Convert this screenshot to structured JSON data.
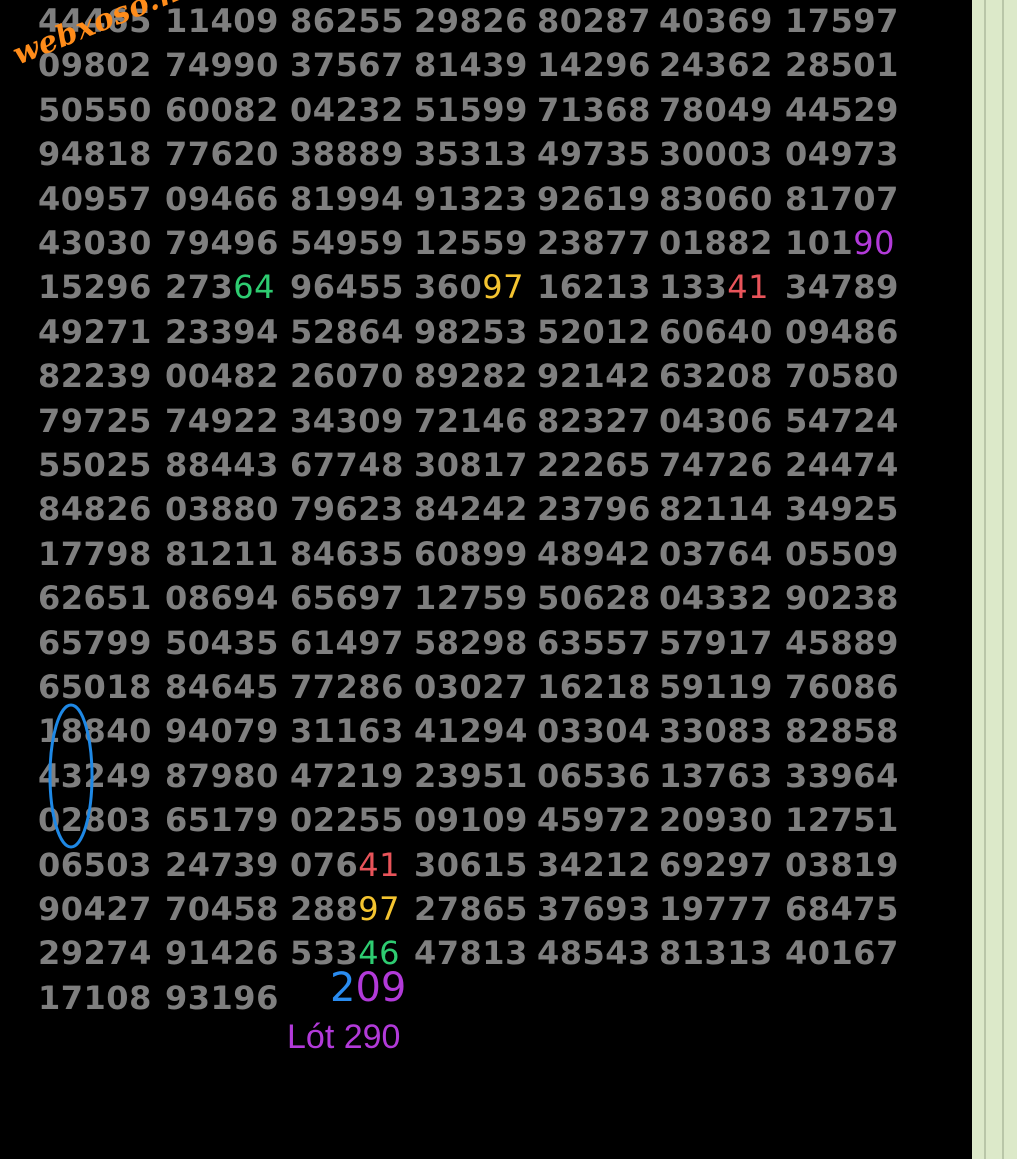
{
  "watermark": "webxoso.net",
  "rows": [
    [
      "44465",
      "11409",
      "86255",
      "29826",
      "80287",
      "40369",
      "17597"
    ],
    [
      "09802",
      "74990",
      "37567",
      "81439",
      "14296",
      "24362",
      "28501"
    ],
    [
      "50550",
      "60082",
      "04232",
      "51599",
      "71368",
      "78049",
      "44529"
    ],
    [
      "94818",
      "77620",
      "38889",
      "35313",
      "49735",
      "30003",
      "04973"
    ],
    [
      "40957",
      "09466",
      "81994",
      "91323",
      "92619",
      "83060",
      "81707"
    ],
    [
      "43030",
      "79496",
      "54959",
      "12559",
      "23877",
      "01882",
      "10190"
    ],
    [
      "15296",
      "27364",
      "96455",
      "36097",
      "16213",
      "13341",
      "34789"
    ],
    [
      "49271",
      "23394",
      "52864",
      "98253",
      "52012",
      "60640",
      "09486"
    ],
    [
      "82239",
      "00482",
      "26070",
      "89282",
      "92142",
      "63208",
      "70580"
    ],
    [
      "79725",
      "74922",
      "34309",
      "72146",
      "82327",
      "04306",
      "54724"
    ],
    [
      "55025",
      "88443",
      "67748",
      "30817",
      "22265",
      "74726",
      "24474"
    ],
    [
      "84826",
      "03880",
      "79623",
      "84242",
      "23796",
      "82114",
      "34925"
    ],
    [
      "17798",
      "81211",
      "84635",
      "60899",
      "48942",
      "03764",
      "05509"
    ],
    [
      "62651",
      "08694",
      "65697",
      "12759",
      "50628",
      "04332",
      "90238"
    ],
    [
      "65799",
      "50435",
      "61497",
      "58298",
      "63557",
      "57917",
      "45889"
    ],
    [
      "65018",
      "84645",
      "77286",
      "03027",
      "16218",
      "59119",
      "76086"
    ],
    [
      "18840",
      "94079",
      "31163",
      "41294",
      "03304",
      "33083",
      "82858"
    ],
    [
      "43249",
      "87980",
      "47219",
      "23951",
      "06536",
      "13763",
      "33964"
    ],
    [
      "02803",
      "65179",
      "02255",
      "09109",
      "45972",
      "20930",
      "12751"
    ],
    [
      "06503",
      "24739",
      "07641",
      "30615",
      "34212",
      "69297",
      "03819"
    ],
    [
      "90427",
      "70458",
      "28897",
      "27865",
      "37693",
      "19777",
      "68475"
    ],
    [
      "29274",
      "91426",
      "53346",
      "47813",
      "48543",
      "81313",
      "40167"
    ],
    [
      "17108",
      "93196"
    ]
  ],
  "highlights": [
    {
      "row": 5,
      "col": 6,
      "digits": "90",
      "color": "#b23ad9"
    },
    {
      "row": 6,
      "col": 1,
      "digits": "64",
      "color": "#2ecc71"
    },
    {
      "row": 6,
      "col": 3,
      "digits": "97",
      "color": "#f4c430"
    },
    {
      "row": 6,
      "col": 5,
      "digits": "41",
      "color": "#e8545a"
    },
    {
      "row": 19,
      "col": 2,
      "digits": "41",
      "color": "#e8545a"
    },
    {
      "row": 20,
      "col": 2,
      "digits": "97",
      "color": "#f4c430"
    },
    {
      "row": 21,
      "col": 2,
      "digits": "46",
      "color": "#2ecc71"
    }
  ],
  "total": {
    "first_digit": "2",
    "rest": "09"
  },
  "note": "Lót 290",
  "colors": {
    "background": "#000000",
    "number": "#7f7f7f",
    "sidebar": "#dce9c9",
    "circle": "#1e88e5",
    "watermark": "#ff8c1a"
  }
}
